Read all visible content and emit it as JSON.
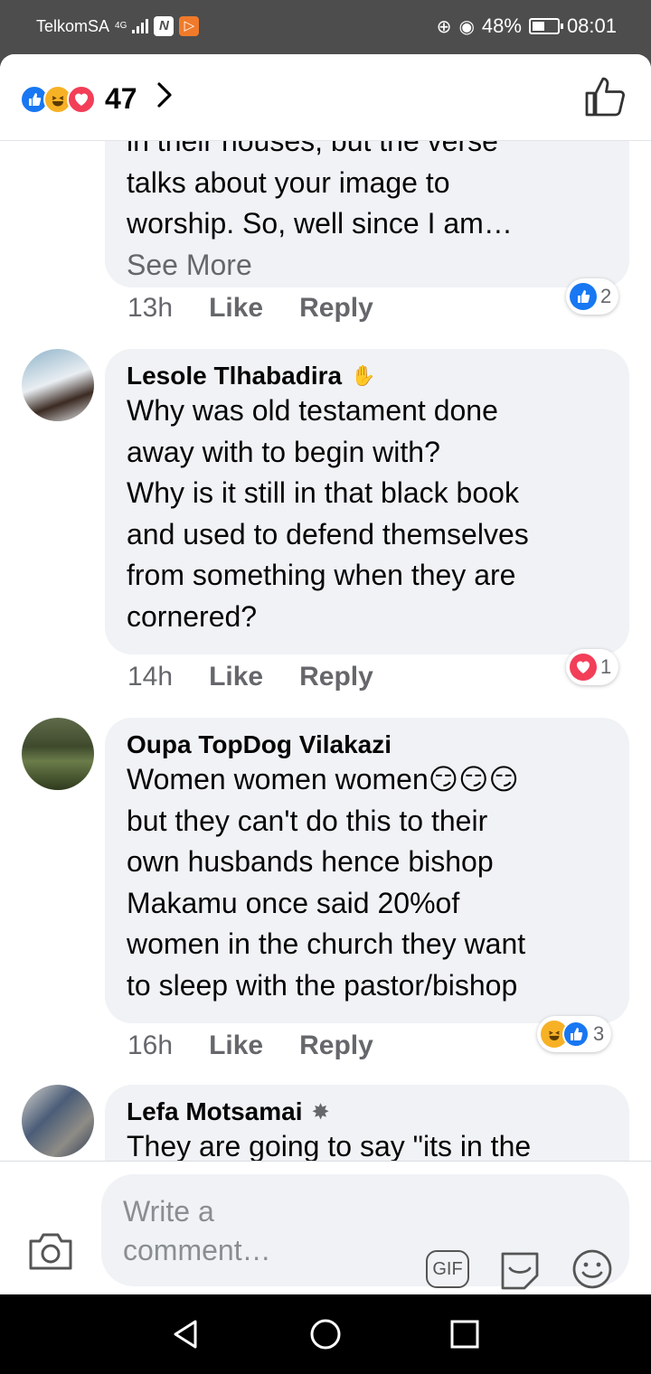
{
  "status_bar": {
    "carrier": "TelkomSA",
    "network": "4G",
    "battery": "48%",
    "time": "08:01"
  },
  "header": {
    "reaction_count": "47"
  },
  "comments": [
    {
      "author": "",
      "text_partial_top": "in their houses, but the verse",
      "text": "talks about your image to\nworship. So, well since I am…",
      "see_more": "See More",
      "time": "13h",
      "like": "Like",
      "reply": "Reply",
      "reaction_count": "2"
    },
    {
      "author": "Lesole Tlhabadira",
      "text": "Why was old testament done\naway with to begin with?\nWhy is it still in that black book\nand used to defend themselves\nfrom something when they are\ncornered?",
      "time": "14h",
      "like": "Like",
      "reply": "Reply",
      "reaction_count": "1"
    },
    {
      "author": "Oupa TopDog Vilakazi",
      "text": "Women women women😏😏😏\nbut they can't do this to their\nown husbands hence bishop\nMakamu once said 20%of\nwomen in the church they want\nto sleep with the pastor/bishop",
      "time": "16h",
      "like": "Like",
      "reply": "Reply",
      "reaction_count": "3"
    },
    {
      "author": "Lefa Motsamai",
      "text": "They are going to say \"its in the"
    }
  ],
  "composer": {
    "placeholder": "Write a\ncomment…",
    "gif_label": "GIF"
  },
  "colors": {
    "accent": "#1877f2",
    "bubble": "#f0f2f5",
    "muted": "#65676b"
  }
}
